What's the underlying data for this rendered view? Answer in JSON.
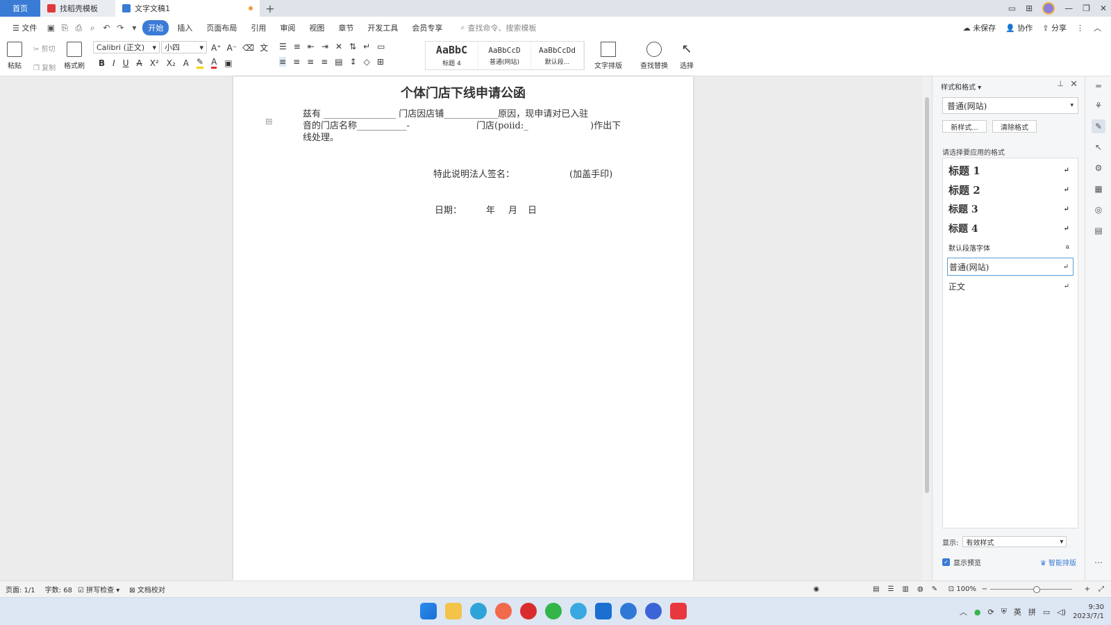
{
  "tabs": {
    "home": "首页",
    "template": "找稻壳模板",
    "doc": "文字文稿1",
    "add": "+"
  },
  "menu": {
    "file": "文件",
    "items": [
      "开始",
      "插入",
      "页面布局",
      "引用",
      "审阅",
      "视图",
      "章节",
      "开发工具",
      "会员专享"
    ],
    "search_placeholder": "查找命令、搜索模板",
    "unsaved": "未保存",
    "collab": "协作",
    "share": "分享"
  },
  "ribbon": {
    "paste": "粘贴",
    "cut": "剪切",
    "copy": "复制",
    "format_painter": "格式刷",
    "font": "Calibri (正文)",
    "size": "小四",
    "styles": [
      {
        "sample": "AaBbC",
        "label": "标题 4"
      },
      {
        "sample": "AaBbCcD",
        "label": "普通(网站)"
      },
      {
        "sample": "AaBbCcDd",
        "label": "默认段..."
      }
    ],
    "text_layout": "文字排版",
    "find_replace": "查找替换",
    "select": "选择"
  },
  "document": {
    "title": "个体门店下线申请公函",
    "para1": "兹有 ________________ 门店因店铺____________原因，现申请对已入驻",
    "para2a": "音的门店名称___________-",
    "para2b": "门店(poiid:_",
    "para2c": ")作出下",
    "para3": "线处理。",
    "signature": "特此说明法人签名：",
    "seal": "(加盖手印)",
    "date_label": "日期：",
    "year": "年",
    "month": "月",
    "day": "日"
  },
  "panel": {
    "title": "样式和格式",
    "current_style": "普通(网站)",
    "new_style": "新样式...",
    "clear_format": "清除格式",
    "choose_label": "请选择要应用的格式",
    "styles": [
      "标题 1",
      "标题 2",
      "标题 3",
      "标题 4",
      "默认段落字体",
      "普通(网站)",
      "正文"
    ],
    "show_label": "显示:",
    "show_value": "有效样式",
    "preview": "显示预览",
    "smart": "智能排版"
  },
  "status": {
    "page": "页面: 1/1",
    "words": "字数: 68",
    "spell": "拼写检查",
    "proof": "文档校对",
    "zoom": "100%"
  },
  "tray": {
    "lang": "英",
    "ime": "拼",
    "time": "9:30",
    "date": "2023/7/1"
  }
}
